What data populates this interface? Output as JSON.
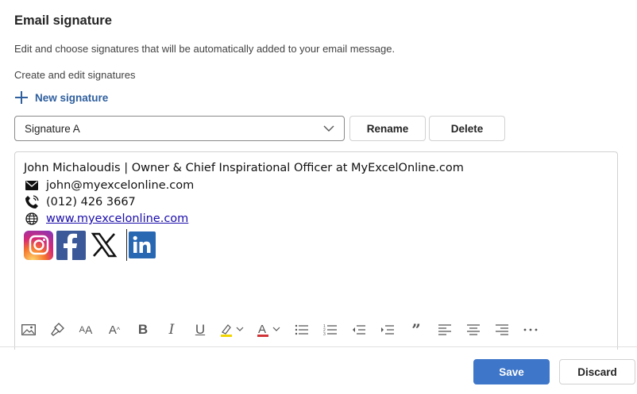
{
  "header": {
    "title": "Email signature",
    "description": "Edit and choose signatures that will be automatically added to your email message.",
    "section_label": "Create and edit signatures"
  },
  "actions": {
    "new_signature_label": "New signature",
    "rename_label": "Rename",
    "delete_label": "Delete"
  },
  "signature_select": {
    "selected": "Signature A"
  },
  "signature": {
    "name_line": "John Michaloudis | Owner & Chief Inspirational Officer at MyExcelOnline.com",
    "email": "john@myexcelonline.com",
    "phone": "(012) 426 3667",
    "website": "www.myexcelonline.com",
    "social_icons": [
      "instagram-icon",
      "facebook-icon",
      "x-icon",
      "linkedin-icon"
    ]
  },
  "toolbar": {
    "items": [
      "insert-picture-icon",
      "format-painter-icon",
      "font-size-icon",
      "increase-font-icon",
      "bold-icon",
      "italic-icon",
      "underline-icon",
      "highlight-icon",
      "font-color-icon",
      "bullets-icon",
      "numbering-icon",
      "decrease-indent-icon",
      "increase-indent-icon",
      "quote-icon",
      "align-left-icon",
      "align-center-icon",
      "align-right-icon",
      "more-options-icon"
    ]
  },
  "footer": {
    "save_label": "Save",
    "discard_label": "Discard"
  },
  "colors": {
    "accent": "#3e76c9",
    "link": "#1a0dab",
    "linkedin": "#2867b2",
    "facebook": "#3b5998",
    "highlight": "#f2d600",
    "font_color": "#d13438"
  }
}
